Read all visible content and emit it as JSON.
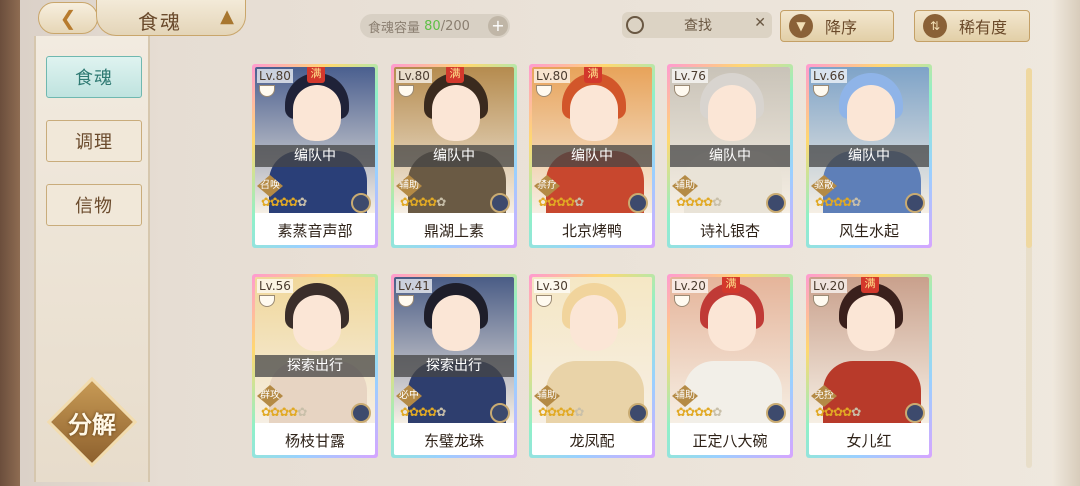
{
  "header": {
    "back_icon": "back-arrow-icon",
    "title": "食魂",
    "title_icon": "crown-icon"
  },
  "capacity": {
    "label": "食魂容量",
    "current": "80",
    "max": "/200",
    "plus": "+"
  },
  "search": {
    "label": "查找",
    "clear": "✕"
  },
  "sort": {
    "desc_label": "降序",
    "rarity_label": "稀有度"
  },
  "sidebar": {
    "items": [
      {
        "label": "食魂",
        "active": true
      },
      {
        "label": "调理",
        "active": false
      },
      {
        "label": "信物",
        "active": false
      }
    ],
    "decompose_label": "分解"
  },
  "cards": [
    {
      "level": "Lv.80",
      "max": "满",
      "status": "编队中",
      "role": "召唤",
      "name": "素蒸音声部",
      "hair": "#1f2238",
      "body": "#2a3f78",
      "bg": "#4a5f8f"
    },
    {
      "level": "Lv.80",
      "max": "满",
      "status": "编队中",
      "role": "辅助",
      "name": "鼎湖上素",
      "hair": "#3a2a1e",
      "body": "#6a5a44",
      "bg": "#b58b4e"
    },
    {
      "level": "Lv.80",
      "max": "满",
      "status": "编队中",
      "role": "禁疗",
      "name": "北京烤鸭",
      "hair": "#d2562a",
      "body": "#c8472e",
      "bg": "#e8a35a"
    },
    {
      "level": "Lv.76",
      "max": "",
      "status": "编队中",
      "role": "辅助",
      "name": "诗礼银杏",
      "hair": "#d8d4cf",
      "body": "#e9e3d7",
      "bg": "#c9c3b8"
    },
    {
      "level": "Lv.66",
      "max": "",
      "status": "编队中",
      "role": "驱散",
      "name": "风生水起",
      "hair": "#8fb4e8",
      "body": "#5e7fb8",
      "bg": "#7ea3c8"
    },
    {
      "level": "Lv.56",
      "max": "",
      "status": "探索出行",
      "role": "群攻",
      "name": "杨枝甘露",
      "hair": "#3a2e2a",
      "body": "#e7d4c2",
      "bg": "#f0d79a"
    },
    {
      "level": "Lv.41",
      "max": "",
      "status": "探索出行",
      "role": "必中",
      "name": "东璧龙珠",
      "hair": "#1e1e2a",
      "body": "#2e3e6e",
      "bg": "#4a5c86"
    },
    {
      "level": "Lv.30",
      "max": "",
      "status": "",
      "role": "辅助",
      "name": "龙凤配",
      "hair": "#f1d49c",
      "body": "#e9d3a8",
      "bg": "#f5e7c4"
    },
    {
      "level": "Lv.20",
      "max": "满",
      "status": "",
      "role": "辅助",
      "name": "正定八大碗",
      "hair": "#c03a36",
      "body": "#f2efe8",
      "bg": "#e5b49a"
    },
    {
      "level": "Lv.20",
      "max": "满",
      "status": "",
      "role": "免控",
      "name": "女儿红",
      "hair": "#3a201c",
      "body": "#b83a2a",
      "bg": "#c9a08c"
    }
  ]
}
